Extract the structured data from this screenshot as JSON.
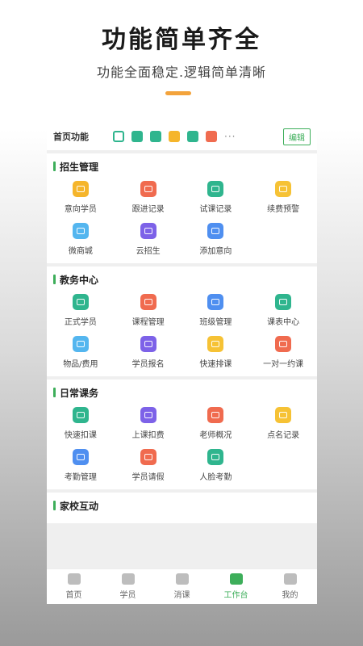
{
  "hero": {
    "title": "功能简单齐全",
    "subtitle": "功能全面稳定.逻辑简单清晰"
  },
  "topbar": {
    "title": "首页功能",
    "mini_icons": [
      "qrcode-icon",
      "doc-icon",
      "mail-icon",
      "user-icon",
      "card-icon",
      "alarm-icon"
    ],
    "more": "···",
    "edit_label": "编辑"
  },
  "sections": [
    {
      "title": "招生管理",
      "items": [
        {
          "label": "意向学员",
          "icon": "intent-student-icon",
          "color": "#f5b52b"
        },
        {
          "label": "跟进记录",
          "icon": "followup-clock-icon",
          "color": "#f06b4f"
        },
        {
          "label": "试课记录",
          "icon": "trial-class-icon",
          "color": "#2fb58e"
        },
        {
          "label": "续费预警",
          "icon": "renew-alert-icon",
          "color": "#f6c235"
        },
        {
          "label": "微商城",
          "icon": "shop-icon",
          "color": "#54b6ef"
        },
        {
          "label": "云招生",
          "icon": "cloud-enroll-icon",
          "color": "#7d62e8"
        },
        {
          "label": "添加意向",
          "icon": "add-intent-icon",
          "color": "#4f8ff0"
        }
      ]
    },
    {
      "title": "教务中心",
      "items": [
        {
          "label": "正式学员",
          "icon": "student-icon",
          "color": "#2fb58e"
        },
        {
          "label": "课程管理",
          "icon": "course-icon",
          "color": "#f06b4f"
        },
        {
          "label": "班级管理",
          "icon": "class-icon",
          "color": "#4f8ff0"
        },
        {
          "label": "课表中心",
          "icon": "schedule-icon",
          "color": "#2fb58e"
        },
        {
          "label": "物品/费用",
          "icon": "goods-icon",
          "color": "#54b6ef"
        },
        {
          "label": "学员报名",
          "icon": "signup-icon",
          "color": "#7d62e8"
        },
        {
          "label": "快速排课",
          "icon": "quick-schedule-icon",
          "color": "#f6c235"
        },
        {
          "label": "一对一约课",
          "icon": "one-on-one-icon",
          "color": "#f06b4f"
        }
      ]
    },
    {
      "title": "日常课务",
      "items": [
        {
          "label": "快速扣课",
          "icon": "quick-deduct-icon",
          "color": "#2fb58e"
        },
        {
          "label": "上课扣费",
          "icon": "class-fee-icon",
          "color": "#7d62e8"
        },
        {
          "label": "老师概况",
          "icon": "teacher-icon",
          "color": "#f06b4f"
        },
        {
          "label": "点名记录",
          "icon": "rollcall-icon",
          "color": "#f6c235"
        },
        {
          "label": "考勤管理",
          "icon": "attendance-icon",
          "color": "#4f8ff0"
        },
        {
          "label": "学员请假",
          "icon": "leave-icon",
          "color": "#f06b4f"
        },
        {
          "label": "人脸考勤",
          "icon": "face-attendance-icon",
          "color": "#2fb58e"
        }
      ]
    },
    {
      "title": "家校互动",
      "items": []
    }
  ],
  "tabbar": [
    {
      "label": "首页",
      "icon": "home-icon",
      "active": false
    },
    {
      "label": "学员",
      "icon": "student-tab-icon",
      "active": false
    },
    {
      "label": "消课",
      "icon": "layers-icon",
      "active": false
    },
    {
      "label": "工作台",
      "icon": "workbench-icon",
      "active": true
    },
    {
      "label": "我的",
      "icon": "profile-icon",
      "active": false
    }
  ],
  "colors": {
    "accent": "#3dae5a",
    "hero_bar": "#f3a33b"
  }
}
